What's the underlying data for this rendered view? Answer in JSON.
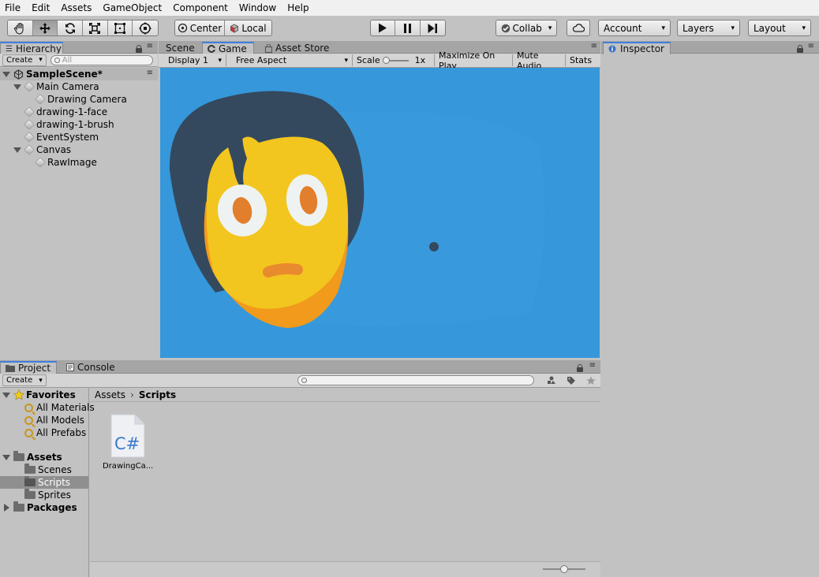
{
  "menu": [
    "File",
    "Edit",
    "Assets",
    "GameObject",
    "Component",
    "Window",
    "Help"
  ],
  "toolbar": {
    "center_label": "Center",
    "local_label": "Local",
    "collab_label": "Collab",
    "account_label": "Account",
    "layers_label": "Layers",
    "layout_label": "Layout"
  },
  "hierarchy": {
    "tab": "Hierarchy",
    "create": "Create",
    "search_placeholder": "All",
    "scene": "SampleScene*",
    "items": [
      {
        "label": "Main Camera"
      },
      {
        "label": "Drawing Camera"
      },
      {
        "label": "drawing-1-face"
      },
      {
        "label": "drawing-1-brush"
      },
      {
        "label": "EventSystem"
      },
      {
        "label": "Canvas"
      },
      {
        "label": "RawImage"
      }
    ]
  },
  "center_tabs": {
    "scene": "Scene",
    "game": "Game",
    "asset_store": "Asset Store"
  },
  "game_bar": {
    "display": "Display 1",
    "aspect": "Free Aspect",
    "scale_label": "Scale",
    "scale_value": "1x",
    "maximize": "Maximize On Play",
    "mute": "Mute Audio",
    "stats": "Stats"
  },
  "inspector": {
    "tab": "Inspector"
  },
  "bottom_tabs": {
    "project": "Project",
    "console": "Console"
  },
  "project": {
    "create": "Create",
    "favorites_label": "Favorites",
    "favorites": [
      "All Materials",
      "All Models",
      "All Prefabs"
    ],
    "assets_label": "Assets",
    "folders": [
      "Scenes",
      "Scripts",
      "Sprites"
    ],
    "packages_label": "Packages",
    "breadcrumb": [
      "Assets",
      "Scripts"
    ],
    "file_icon_text": "C#",
    "file_name": "DrawingCa..."
  },
  "colors": {
    "game_bg": "#3697da",
    "face": "#f3c51f",
    "chin": "#f19a1c",
    "hair": "#34495e",
    "eye_white": "#eef3f1",
    "pupil": "#e27f2c",
    "mouth": "#e88a2e",
    "selection": "#8f8f8f",
    "tab_accent": "#3f7ee0"
  }
}
